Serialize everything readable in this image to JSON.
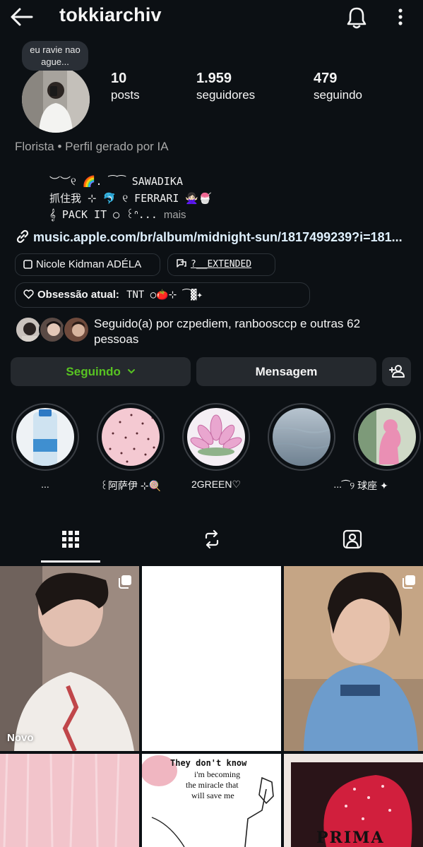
{
  "header": {
    "username": "tokkiarchiv",
    "back_icon": "arrow-left-icon",
    "bell_icon": "bell-icon",
    "more_icon": "kebab-icon"
  },
  "profile": {
    "note": "eu ravie nao ague...",
    "stats": [
      {
        "value": "10",
        "label": "posts"
      },
      {
        "value": "1.959",
        "label": "seguidores"
      },
      {
        "value": "479",
        "label": "seguindo"
      }
    ],
    "category": "Florista • Perfil gerado por IA",
    "bio_lines": [
      "︶︶୧ 🌈. ⁀⁀ SAWADIKA",
      "抓住我 ⊹ 🐬 ୧ FERRARI 🙅🏻‍♀️🍧",
      "𝄞 PACK IT ○ ꒰ᐢ..."
    ],
    "bio_more": "mais",
    "link": "music.apple.com/br/album/midnight-sun/1817499239?i=181...",
    "chips": [
      {
        "label": "Nicole Kidman  ADÉLA",
        "icon": "square-icon"
      },
      {
        "label": "?__EXTENDED",
        "icon": "threads-icon"
      }
    ],
    "obsession_label": "Obsessão atual:",
    "obsession_value": "TNT ○🍅⊹  ⁀▓✦",
    "followed_by": "Seguido(a) por czpediem, ranboosccp e outras 62 pessoas"
  },
  "actions": {
    "following": "Seguindo",
    "message": "Mensagem",
    "add_user_icon": "add-person-icon"
  },
  "highlights": [
    {
      "label": "...",
      "colors": [
        "#e9eef2",
        "#7fb6de"
      ]
    },
    {
      "label": "꒰阿萨伊 ⊹🍭",
      "colors": [
        "#f4c9d2",
        "#b05a6a"
      ]
    },
    {
      "label": "2GREEN♡",
      "colors": [
        "#f7e6ef",
        "#d27bb0"
      ]
    },
    {
      "label": "...",
      "colors": [
        "#a9b8c4",
        "#5e7284"
      ]
    },
    {
      "label": "⁀୨ 球座 ✦",
      "colors": [
        "#e8b6c7",
        "#7d9a79"
      ]
    }
  ],
  "tabs": [
    {
      "name": "grid",
      "icon": "grid-icon",
      "active": true
    },
    {
      "name": "reels",
      "icon": "repost-icon",
      "active": false
    },
    {
      "name": "tagged",
      "icon": "tagged-user-icon",
      "active": false
    }
  ],
  "posts": [
    {
      "badge": "Novo",
      "multi": true,
      "colors": [
        "#b59c8e",
        "#3a322d"
      ]
    },
    {
      "badge": "",
      "multi": false,
      "colors": [
        "#ffffff",
        "#ffffff"
      ]
    },
    {
      "badge": "",
      "multi": true,
      "colors": [
        "#c7a888",
        "#5f8bb8"
      ]
    },
    {
      "badge": "",
      "multi": false,
      "colors": [
        "#f2c6cc",
        "#e8a9b2"
      ]
    },
    {
      "badge": "",
      "multi": false,
      "colors": [
        "#ffffff",
        "#f0e6e6"
      ],
      "text": [
        "They don't know",
        "i'm becoming",
        "the miracle that",
        "will save me"
      ]
    },
    {
      "badge": "",
      "multi": false,
      "colors": [
        "#d01f3c",
        "#2a1a1d"
      ],
      "text": [
        "PRIMA"
      ]
    }
  ]
}
